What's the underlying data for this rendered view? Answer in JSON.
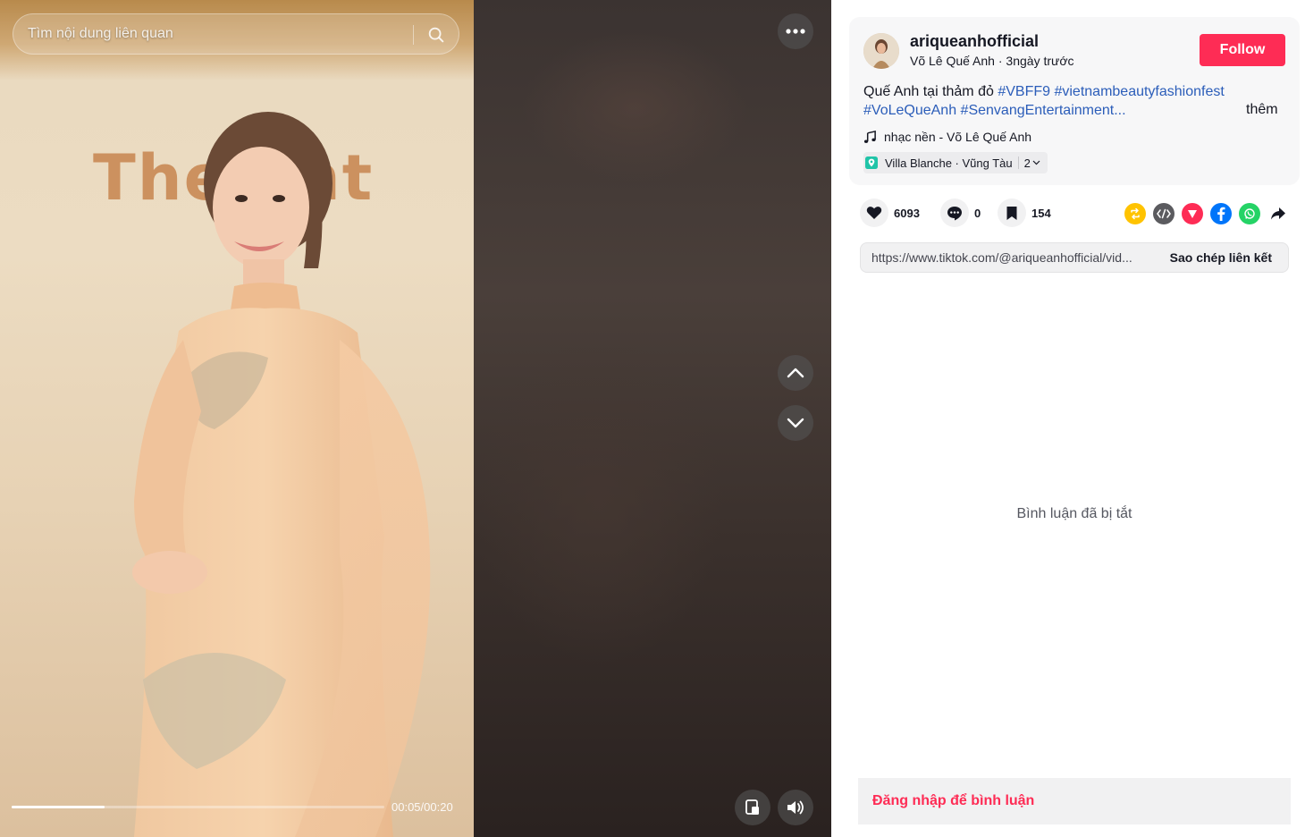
{
  "search": {
    "placeholder": "Tìm nội dung liên quan"
  },
  "video": {
    "backdrop_text": "The      ent",
    "progress": 0.25,
    "time": "00:05/00:20"
  },
  "author": {
    "username": "ariqueanhofficial",
    "display_name": "Võ Lê Quế Anh",
    "separator": " · ",
    "posted": "3ngày trước",
    "follow_label": "Follow"
  },
  "caption": {
    "text": "Quế Anh tại thảm đỏ ",
    "hashtags": [
      "#VBFF9",
      "#vietnambeautyfashionfest",
      "#VoLeQueAnh",
      "#SenvangEntertainment..."
    ],
    "more_label": "thêm"
  },
  "music": {
    "icon": "music-note-icon",
    "label": "nhạc nền - Võ Lê Quế Anh"
  },
  "location": {
    "icon": "location-pin-icon",
    "label": "Villa Blanche · Vũng Tàu",
    "extra": "2"
  },
  "stats": {
    "likes": "6093",
    "comments": "0",
    "saves": "154"
  },
  "share": {
    "icons": [
      "repost-icon",
      "embed-icon",
      "send-icon",
      "facebook-icon",
      "whatsapp-icon",
      "share-arrow-icon"
    ],
    "colors": {
      "repost": "#FFC300",
      "embed": "#5B5B5F",
      "send": "#FE2C55",
      "facebook": "#0075FA",
      "whatsapp": "#25D366"
    }
  },
  "link": {
    "url": "https://www.tiktok.com/@ariqueanhofficial/vid...",
    "copy_label": "Sao chép liên kết"
  },
  "comments": {
    "disabled_text": "Bình luận đã bị tắt"
  },
  "login": {
    "prompt": "Đăng nhập để bình luận"
  },
  "colors": {
    "accent": "#FE2C55",
    "hashtag": "#2B5DB9",
    "text": "#161823"
  }
}
